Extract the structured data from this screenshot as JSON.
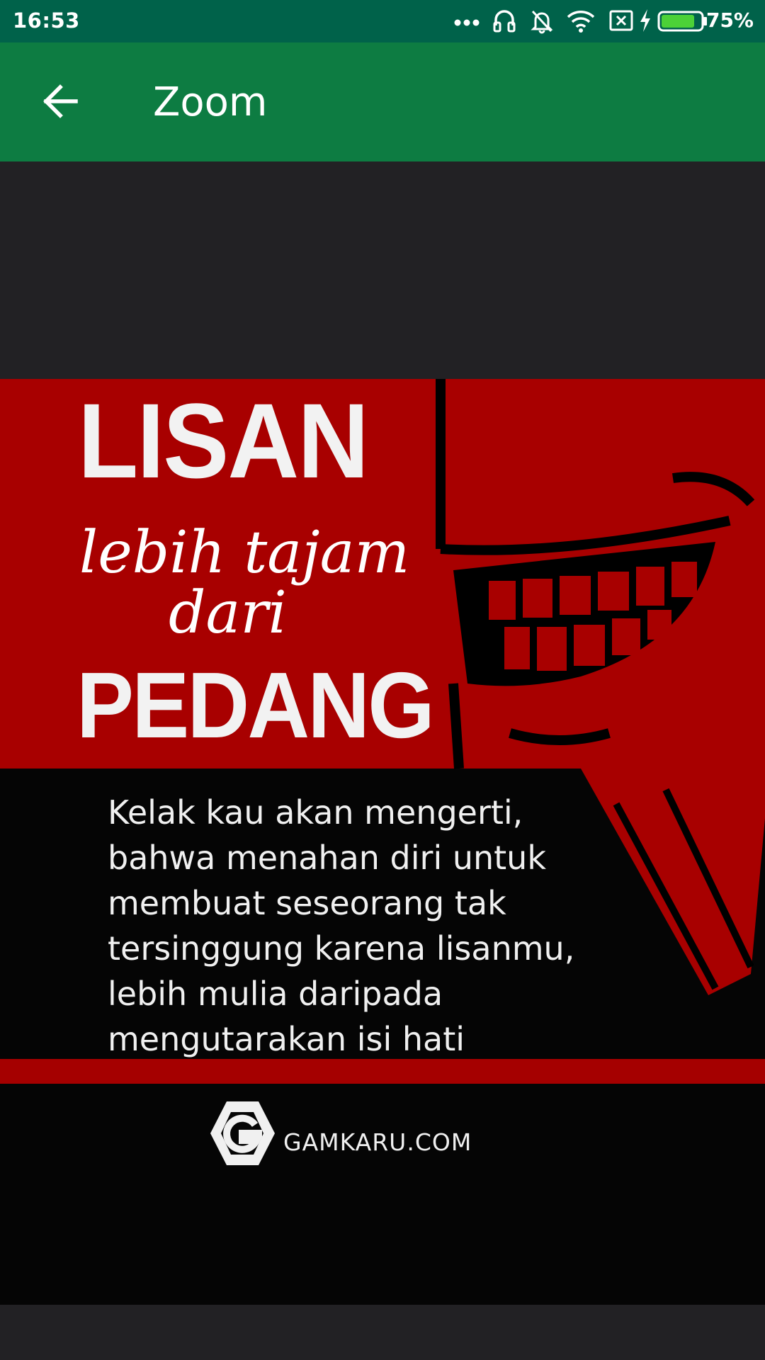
{
  "status_bar": {
    "time": "16:53",
    "battery_percent": "75%",
    "icons": [
      "more-dots-icon",
      "headset-icon",
      "silent-icon",
      "wifi-icon",
      "sim-x-icon",
      "charging-icon",
      "battery-icon"
    ]
  },
  "app_bar": {
    "title": "Zoom",
    "back_icon": "arrow-back-icon"
  },
  "image": {
    "headline_1": "LISAN",
    "headline_2": "lebih tajam",
    "headline_3": "dari",
    "headline_4": "PEDANG",
    "quote": "Kelak kau akan mengerti,\nbahwa menahan diri untuk\nmembuat seseorang tak\ntersinggung karena lisanmu,\nlebih mulia daripada\nmengutarakan isi hati",
    "logo_text": "GAMKARU.COM"
  },
  "colors": {
    "status_bar": "#00624a",
    "app_bar": "#0d7c42",
    "background": "#222124",
    "image_red": "#a80000",
    "image_black": "#050505"
  }
}
